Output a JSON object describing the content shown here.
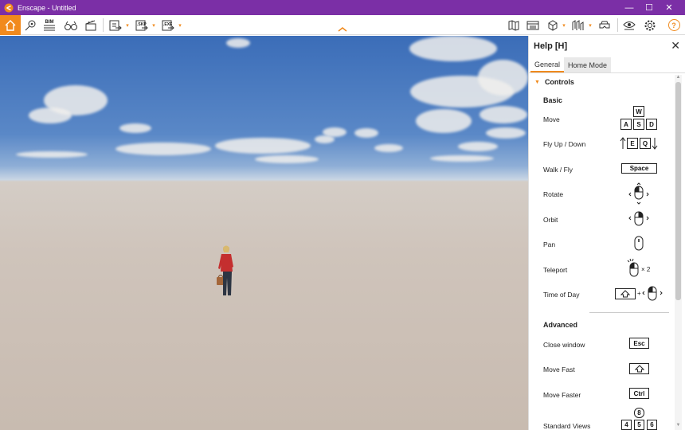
{
  "window": {
    "title": "Enscape - Untitled",
    "minimize": "—",
    "maximize": "☐",
    "close": "✕"
  },
  "toolbar": {
    "bim_label": "BIM",
    "skp_label": ".SKP",
    "exe_label": ".EXE",
    "caret": "▾",
    "help_label": "?",
    "accent": "#f18a1d",
    "collapse_arrow": "^"
  },
  "help": {
    "title": "Help [H]",
    "close": "✕",
    "tabs": [
      "General",
      "Home Mode"
    ],
    "active_tab": "General",
    "controls_header": "Controls",
    "basic": {
      "heading": "Basic",
      "rows": [
        {
          "label": "Move",
          "keys": [
            "W",
            "A",
            "S",
            "D"
          ]
        },
        {
          "label": "Fly Up / Down",
          "keys": [
            "E",
            "Q"
          ]
        },
        {
          "label": "Walk / Fly",
          "keys": [
            "Space"
          ]
        },
        {
          "label": "Rotate",
          "icon": "mouse-left-drag-icon"
        },
        {
          "label": "Orbit",
          "icon": "mouse-right-drag-icon"
        },
        {
          "label": "Pan",
          "icon": "mouse-middle-icon"
        },
        {
          "label": "Teleport",
          "icon": "mouse-double-click-icon",
          "suffix": "× 2"
        },
        {
          "label": "Time of Day",
          "icon": "shift-plus-mouse-icon",
          "plus": "+"
        }
      ]
    },
    "advanced": {
      "heading": "Advanced",
      "rows": [
        {
          "label": "Close window",
          "keys": [
            "Esc"
          ]
        },
        {
          "label": "Move Fast",
          "icon": "shift-key-icon"
        },
        {
          "label": "Move Faster",
          "keys": [
            "Ctrl"
          ]
        },
        {
          "label": "Standard Views",
          "keys": [
            "8",
            "4",
            "5",
            "6"
          ]
        }
      ]
    }
  }
}
